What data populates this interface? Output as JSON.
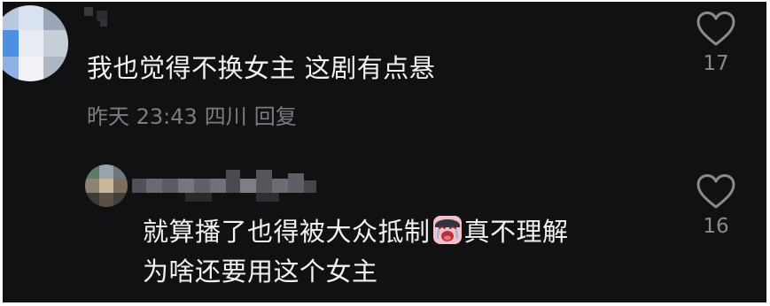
{
  "comments": [
    {
      "text": "我也觉得不换女主 这剧有点悬",
      "time": "昨天 23:43",
      "location": "四川",
      "reply_label": "回复",
      "likes": "17"
    },
    {
      "line1_a": "就算播了也得被大众抵制",
      "emoji": "crying-face-emoji",
      "line1_b": "真不理解",
      "line2": "为啥还要用这个女主",
      "likes": "16"
    }
  ],
  "colors": {
    "background": "#111113",
    "text": "#f2f2f2",
    "meta": "#7c7c82"
  }
}
